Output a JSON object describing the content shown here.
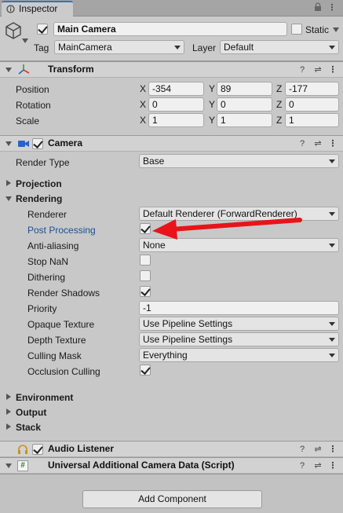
{
  "tab": {
    "title": "Inspector",
    "icons": [
      "info-icon",
      "lock-icon",
      "more-icon"
    ]
  },
  "object": {
    "enabled": true,
    "name": "Main Camera",
    "static_label": "Static",
    "tag_label": "Tag",
    "tag_value": "MainCamera",
    "layer_label": "Layer",
    "layer_value": "Default"
  },
  "transform": {
    "title": "Transform",
    "rows": [
      {
        "label": "Position",
        "x": "-354",
        "y": "89",
        "z": "-177"
      },
      {
        "label": "Rotation",
        "x": "0",
        "y": "0",
        "z": "0"
      },
      {
        "label": "Scale",
        "x": "1",
        "y": "1",
        "z": "1"
      }
    ],
    "axis": {
      "x": "X",
      "y": "Y",
      "z": "Z"
    }
  },
  "camera": {
    "title": "Camera",
    "render_type_label": "Render Type",
    "render_type_value": "Base",
    "projection_label": "Projection",
    "rendering_label": "Rendering",
    "rows": {
      "renderer_label": "Renderer",
      "renderer_value": "Default Renderer (ForwardRenderer)",
      "post_processing_label": "Post Processing",
      "anti_aliasing_label": "Anti-aliasing",
      "anti_aliasing_value": "None",
      "stop_nan_label": "Stop NaN",
      "dithering_label": "Dithering",
      "render_shadows_label": "Render Shadows",
      "priority_label": "Priority",
      "priority_value": "-1",
      "opaque_texture_label": "Opaque Texture",
      "opaque_texture_value": "Use Pipeline Settings",
      "depth_texture_label": "Depth Texture",
      "depth_texture_value": "Use Pipeline Settings",
      "culling_mask_label": "Culling Mask",
      "culling_mask_value": "Everything",
      "occlusion_culling_label": "Occlusion Culling"
    },
    "environment_label": "Environment",
    "output_label": "Output",
    "stack_label": "Stack"
  },
  "audio_listener": {
    "title": "Audio Listener"
  },
  "uacd": {
    "title": "Universal Additional Camera Data (Script)"
  },
  "add_component_label": "Add Component",
  "colors": {
    "accent_blue": "#3a72b0",
    "arrow_red": "#e8141a",
    "label_blue": "#1d4f94"
  }
}
